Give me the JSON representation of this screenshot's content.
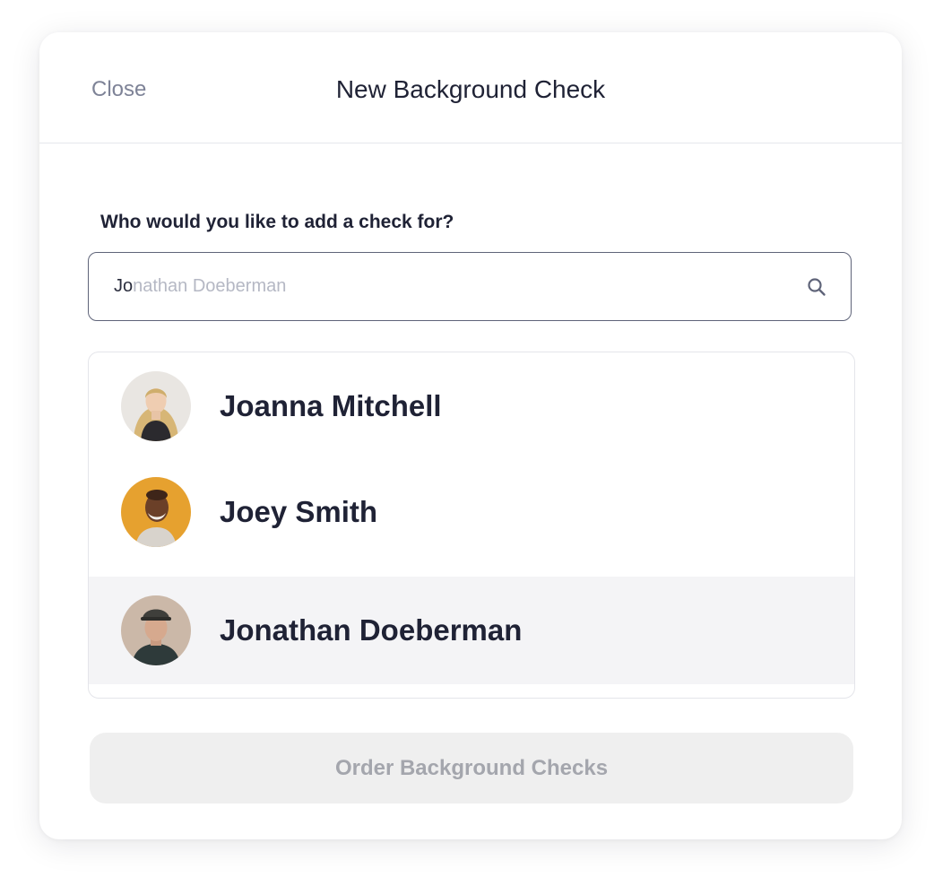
{
  "modal": {
    "close_label": "Close",
    "title": "New Background Check"
  },
  "form": {
    "question_label": "Who would you like to add a check for?"
  },
  "search": {
    "typed_value": "Jo",
    "autocomplete_suggestion": "nathan Doeberman"
  },
  "results": [
    {
      "name": "Joanna Mitchell",
      "selected": false
    },
    {
      "name": "Joey Smith",
      "selected": false
    },
    {
      "name": "Jonathan Doeberman",
      "selected": true
    }
  ],
  "actions": {
    "order_label": "Order Background Checks",
    "order_enabled": false
  },
  "icons": {
    "search": "search-icon"
  },
  "colors": {
    "text_primary": "#1f2235",
    "text_muted": "#7e8397",
    "selected_row": "#f4f4f6",
    "disabled_button_bg": "#efefef",
    "disabled_button_text": "#a4a6ad",
    "avatar_joey_bg": "#e6a12f"
  }
}
